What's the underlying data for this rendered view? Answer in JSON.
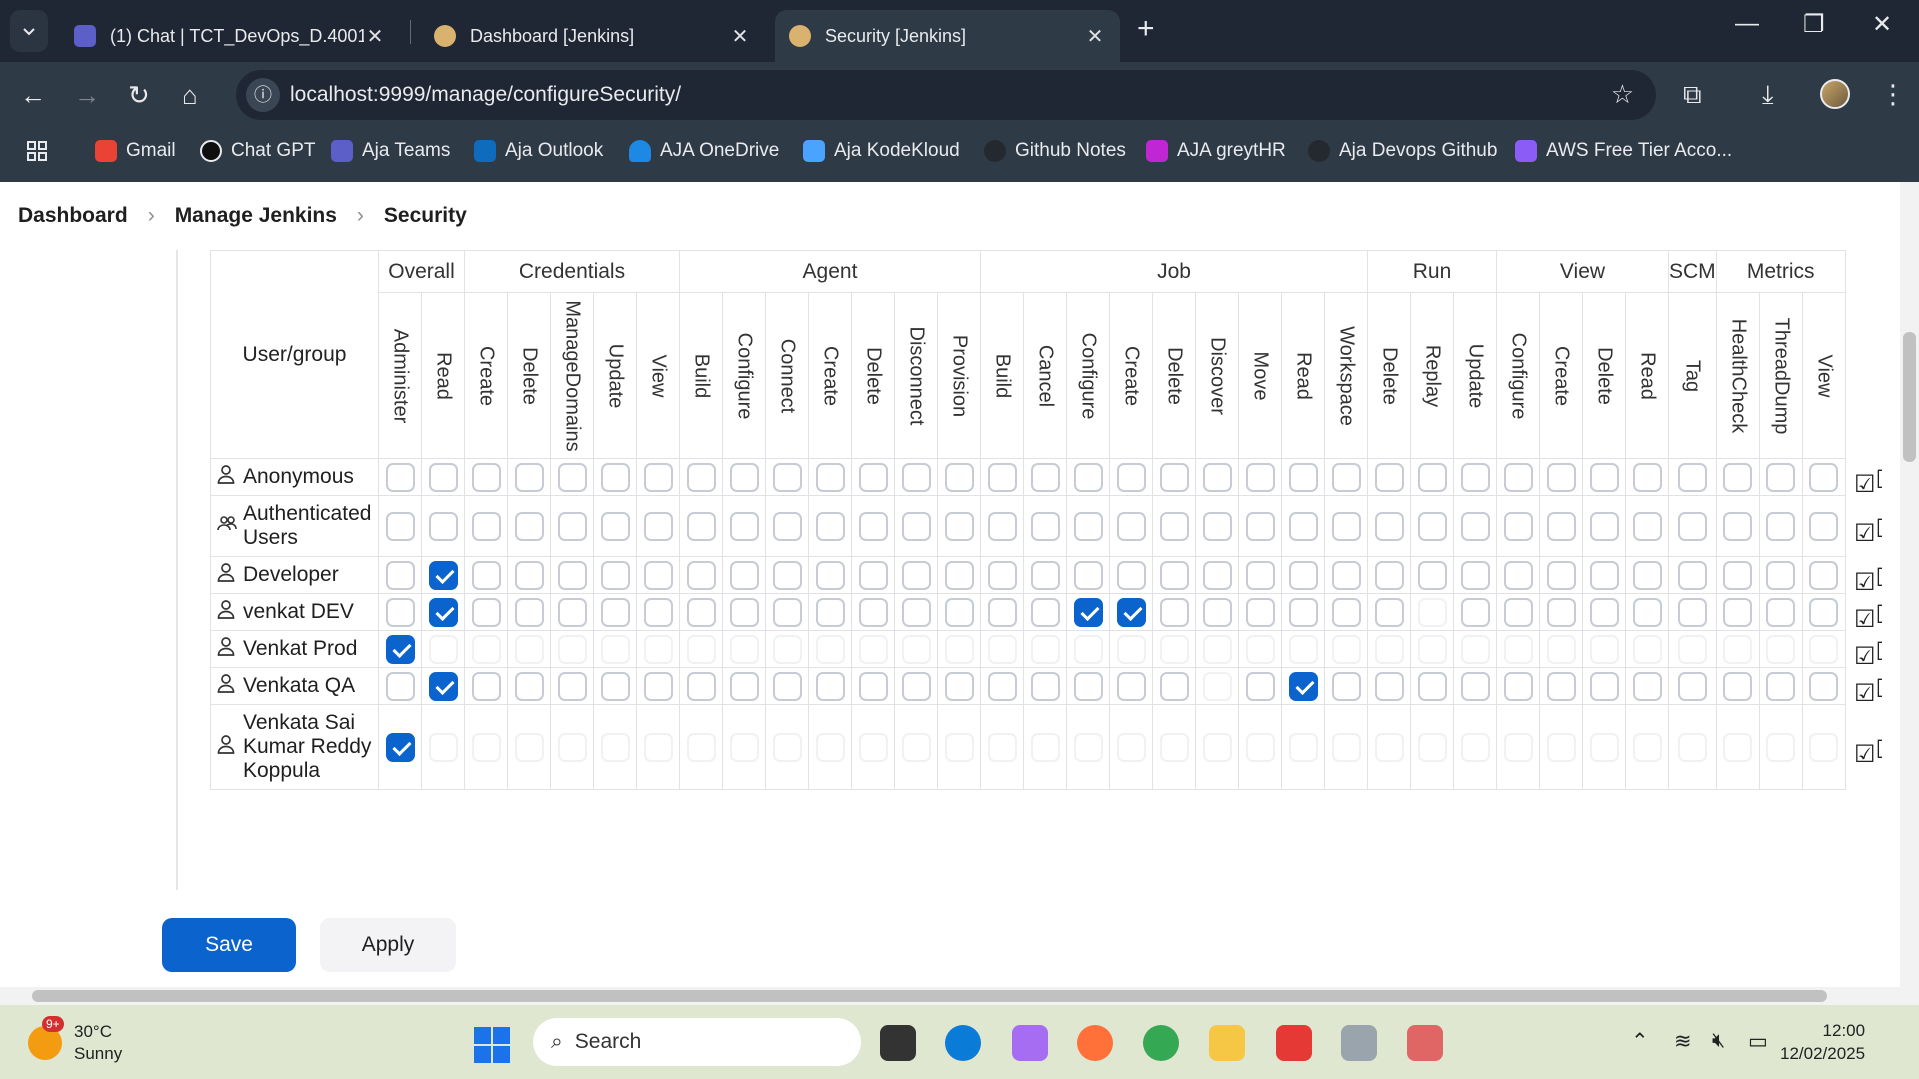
{
  "browser": {
    "tabs": [
      {
        "title": "(1) Chat | TCT_DevOps_D.4001 |",
        "active": false,
        "favicon_color": "#5b5fc7"
      },
      {
        "title": "Dashboard [Jenkins]",
        "active": false,
        "favicon_color": "#d8b26e"
      },
      {
        "title": "Security [Jenkins]",
        "active": true,
        "favicon_color": "#d8b26e"
      }
    ],
    "url": "localhost:9999/manage/configureSecurity/",
    "bookmarks": [
      {
        "label": "Gmail",
        "color": "#ea4335"
      },
      {
        "label": "Chat GPT",
        "color": "#0f0f0f"
      },
      {
        "label": "Aja Teams",
        "color": "#5b5fc7"
      },
      {
        "label": "Aja Outlook",
        "color": "#0f6cbd"
      },
      {
        "label": "AJA OneDrive",
        "color": "#1e88e5"
      },
      {
        "label": "Aja KodeKloud",
        "color": "#4aa3ff"
      },
      {
        "label": "Github Notes",
        "color": "#24292f"
      },
      {
        "label": "AJA greytHR",
        "color": "#c026d3"
      },
      {
        "label": "Aja Devops Github",
        "color": "#24292f"
      },
      {
        "label": "AWS Free Tier Acco...",
        "color": "#8b5cf6"
      }
    ]
  },
  "breadcrumb": [
    "Dashboard",
    "Manage Jenkins",
    "Security"
  ],
  "matrix": {
    "user_header": "User/group",
    "groups": [
      {
        "name": "Overall",
        "span": 2
      },
      {
        "name": "Credentials",
        "span": 5
      },
      {
        "name": "Agent",
        "span": 7
      },
      {
        "name": "Job",
        "span": 9
      },
      {
        "name": "Run",
        "span": 3
      },
      {
        "name": "View",
        "span": 4
      },
      {
        "name": "SCM",
        "span": 1
      },
      {
        "name": "Metrics",
        "span": 3
      }
    ],
    "permissions": [
      "Administer",
      "Read",
      "Create",
      "Delete",
      "ManageDomains",
      "Update",
      "View",
      "Build",
      "Configure",
      "Connect",
      "Create",
      "Delete",
      "Disconnect",
      "Provision",
      "Build",
      "Cancel",
      "Configure",
      "Create",
      "Delete",
      "Discover",
      "Move",
      "Read",
      "Workspace",
      "Delete",
      "Replay",
      "Update",
      "Configure",
      "Create",
      "Delete",
      "Read",
      "Tag",
      "HealthCheck",
      "ThreadDump",
      "View"
    ],
    "rows": [
      {
        "name": "Anonymous",
        "type": "user",
        "checked": [],
        "faint": []
      },
      {
        "name": "Authenticated Users",
        "type": "group",
        "checked": [],
        "faint": []
      },
      {
        "name": "Developer",
        "type": "user",
        "checked": [
          1
        ],
        "faint": []
      },
      {
        "name": "venkat DEV",
        "type": "user",
        "checked": [
          1,
          16,
          17
        ],
        "faint": [
          24
        ]
      },
      {
        "name": "Venkat Prod",
        "type": "user",
        "checked": [
          0
        ],
        "faint": "all"
      },
      {
        "name": "Venkata QA",
        "type": "user",
        "checked": [
          1,
          21
        ],
        "faint": [
          19
        ]
      },
      {
        "name": "Venkata Sai Kumar Reddy Koppula",
        "type": "user",
        "checked": [
          0
        ],
        "faint": "all"
      }
    ]
  },
  "actions": {
    "save": "Save",
    "apply": "Apply"
  },
  "taskbar": {
    "weather_temp": "30°C",
    "weather_desc": "Sunny",
    "notif_badge": "9+",
    "search_placeholder": "Search",
    "time": "12:00",
    "date": "12/02/2025"
  }
}
